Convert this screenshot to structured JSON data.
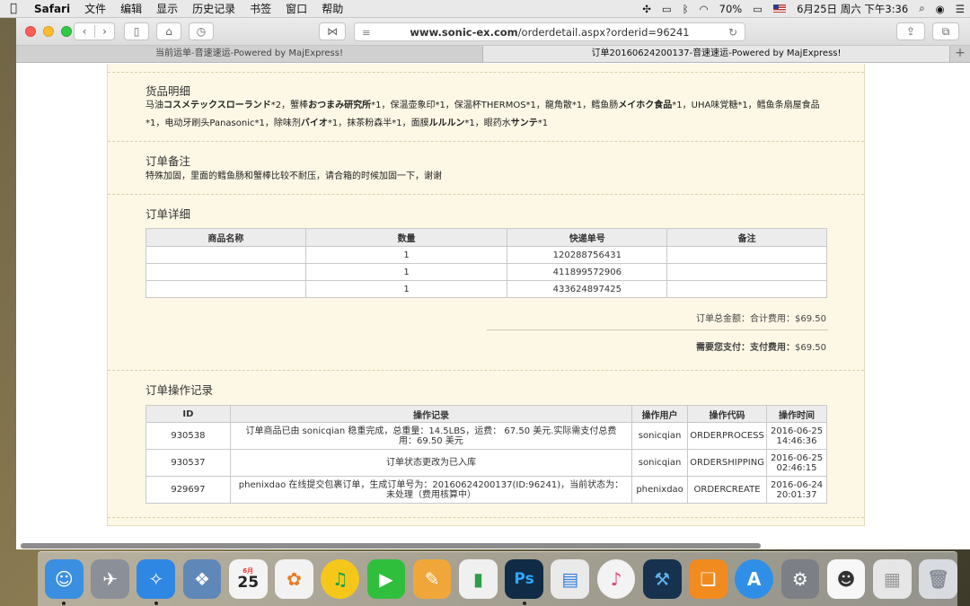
{
  "menubar": {
    "app_name": "Safari",
    "items": [
      "文件",
      "编辑",
      "显示",
      "历史记录",
      "书签",
      "窗口",
      "帮助"
    ],
    "battery": "70%",
    "datetime": "6月25日 周六 下午3:36"
  },
  "browser": {
    "url_host": "www.sonic-ex.com",
    "url_path": "/orderdetail.aspx?orderid=96241",
    "tabs": [
      "当前运单-音速速运-Powered by MajExpress!",
      "订单20160624200137-音速速运-Powered by MajExpress!"
    ]
  },
  "goods": {
    "title": "货品明细",
    "line1_html": "马油<b>コスメテックスローランド</b>*2，蟹棒<b>おつまみ研究所</b>*1，保温壶象印*1，保温杯THERMOS*1，龍角散*1，鳕鱼肠<b>メイホク食品</b>*1，UHA味覚糖*1，鳕鱼条扇屋食品",
    "line2_html": "*1，电动牙刷头Panasonic*1，除味剂<b>バイオ</b>*1，抹茶粉森半*1，面膜<b>ルルルン</b>*1，眼药水<b>サンテ</b>*1"
  },
  "remark": {
    "title": "订单备注",
    "text": "特殊加固，里面的鳕鱼肠和蟹棒比较不耐压，请合箱的时候加固一下，谢谢"
  },
  "detail": {
    "title": "订单详细",
    "headers": [
      "商品名称",
      "数量",
      "快递单号",
      "备注"
    ],
    "rows": [
      [
        "",
        "1",
        "120288756431",
        ""
      ],
      [
        "",
        "1",
        "411899572906",
        ""
      ],
      [
        "",
        "1",
        "433624897425",
        ""
      ]
    ],
    "total_label": "订单总金额：合计费用：",
    "total_value": "$69.50",
    "pay_label": "需要您支付：支付费用：",
    "pay_value": "$69.50"
  },
  "log": {
    "title": "订单操作记录",
    "headers": [
      "ID",
      "操作记录",
      "操作用户",
      "操作代码",
      "操作时间"
    ],
    "rows": [
      [
        "930538",
        "订单商品已由 sonicqian 稳重完成，总重量：14.5LBS，运费： 67.50 美元.实际需支付总费用：69.50 美元",
        "sonicqian",
        "ORDERPROCESS",
        "2016-06-25 14:46:36"
      ],
      [
        "930537",
        "订单状态更改为已入库",
        "sonicqian",
        "ORDERSHIPPING",
        "2016-06-25 02:46:15"
      ],
      [
        "929697",
        "phenixdao 在线提交包裹订单，生成订单号为：20160624200137(ID:96241)，当前状态为：未处理（费用核算中）",
        "phenixdao",
        "ORDERCREATE",
        "2016-06-24 20:01:37"
      ]
    ]
  },
  "dock": {
    "icons": [
      {
        "name": "finder-icon",
        "color": "#3b8fe0"
      },
      {
        "name": "launchpad-icon",
        "color": "#8a8f98"
      },
      {
        "name": "safari-icon",
        "color": "#2f87e4"
      },
      {
        "name": "preview-icon",
        "color": "#5f87b8"
      },
      {
        "name": "calendar-icon",
        "color": "#f4f4f4"
      },
      {
        "name": "photos-icon",
        "color": "#f2f2f2"
      },
      {
        "name": "qq-music-icon",
        "color": "#f6c71b"
      },
      {
        "name": "facetime-icon",
        "color": "#2fbf3d"
      },
      {
        "name": "pages-icon",
        "color": "#f1a639"
      },
      {
        "name": "numbers-icon",
        "color": "#f0f0f0"
      },
      {
        "name": "photoshop-icon",
        "color": "#0f2b46"
      },
      {
        "name": "keynote-icon",
        "color": "#eaeaea"
      },
      {
        "name": "itunes-icon",
        "color": "#f3f3f3"
      },
      {
        "name": "xcode-icon",
        "color": "#16324f"
      },
      {
        "name": "ibooks-icon",
        "color": "#f28b1f"
      },
      {
        "name": "app-store-icon",
        "color": "#2f8fe6"
      },
      {
        "name": "system-preferences-icon",
        "color": "#7c7f85"
      },
      {
        "name": "mac-os-icon",
        "color": "#f7f7f7"
      },
      {
        "name": "documents-stack-icon",
        "color": "#e6e6e6"
      },
      {
        "name": "trash-icon",
        "color": "#d8dbe0"
      }
    ],
    "calendar_month": "6月",
    "calendar_day": "25"
  }
}
